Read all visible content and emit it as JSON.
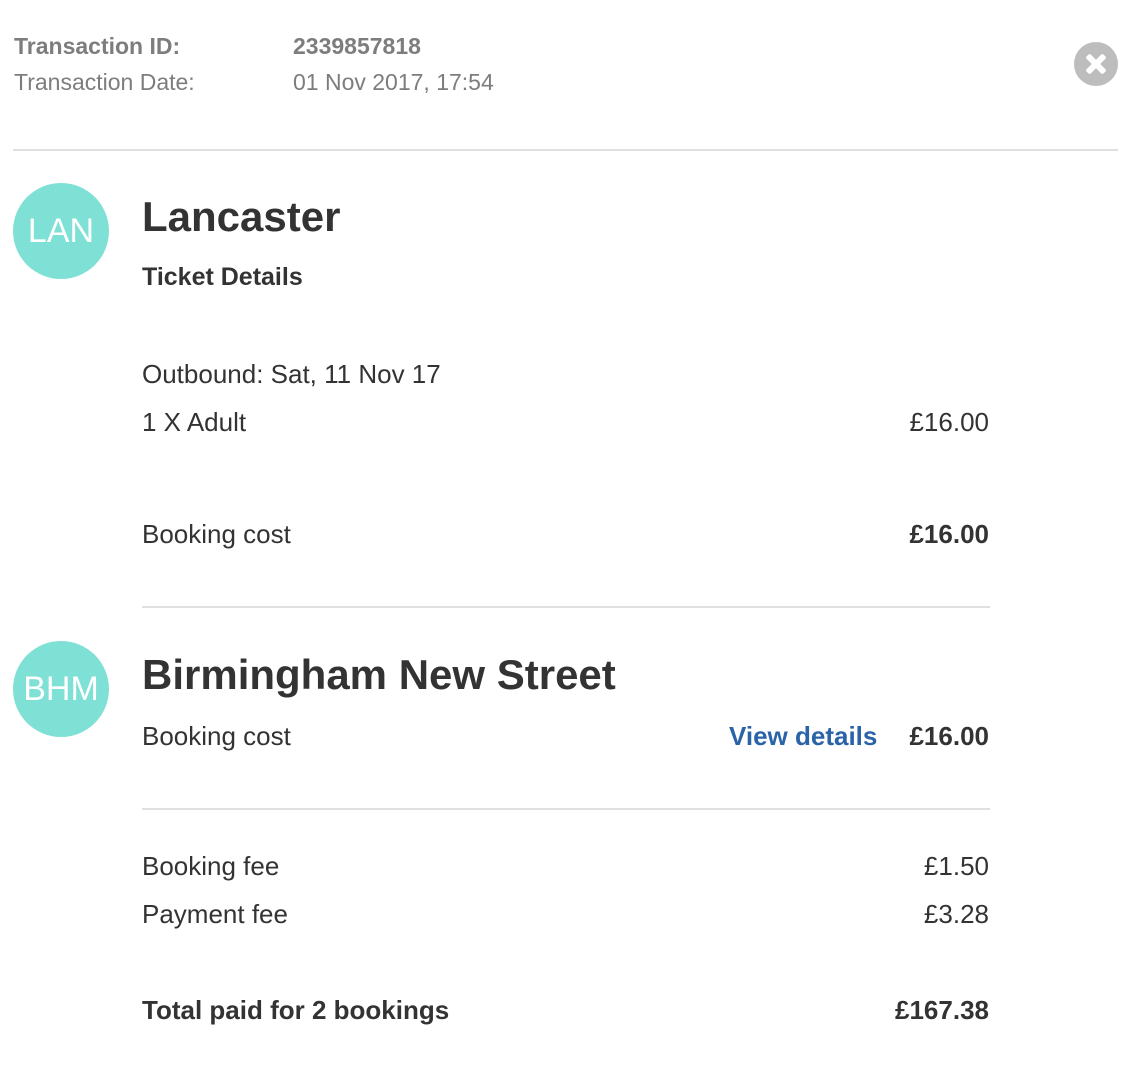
{
  "transaction": {
    "id_label": "Transaction ID:",
    "id_value": "2339857818",
    "date_label": "Transaction Date:",
    "date_value": "01 Nov 2017, 17:54"
  },
  "close_icon": "close-icon",
  "colors": {
    "avatar": "#7fe0d6",
    "link": "#2b63a8",
    "muted": "#7d7d7d",
    "text": "#333333"
  },
  "bookings": [
    {
      "avatar": "LAN",
      "station": "Lancaster",
      "section_title": "Ticket Details",
      "outbound": "Outbound: Sat, 11 Nov 17",
      "ticket_label": "1 X Adult",
      "ticket_price": "£16.00",
      "cost_label": "Booking cost",
      "cost_value": "£16.00"
    },
    {
      "avatar": "BHM",
      "station": "Birmingham New Street",
      "cost_label": "Booking cost",
      "details_link": "View details",
      "cost_value": "£16.00"
    }
  ],
  "fees": [
    {
      "label": "Booking fee",
      "value": "£1.50"
    },
    {
      "label": "Payment fee",
      "value": "£3.28"
    }
  ],
  "total": {
    "label": "Total paid for 2 bookings",
    "value": "£167.38"
  }
}
